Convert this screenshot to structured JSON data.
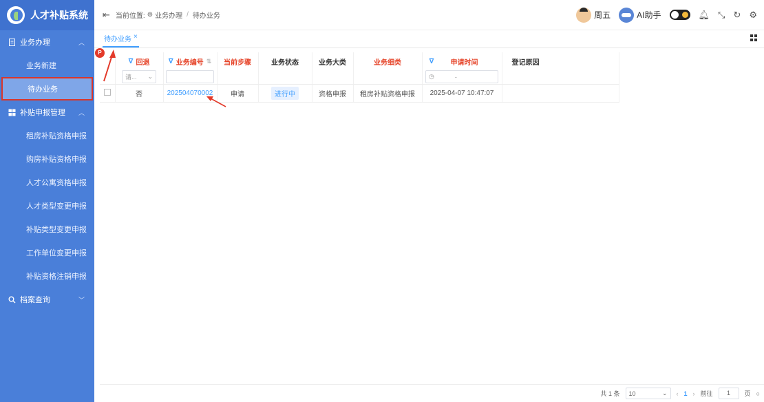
{
  "app": {
    "title": "人才补贴系统"
  },
  "sidebar": {
    "groups": [
      {
        "label": "业务办理",
        "items": [
          {
            "label": "业务新建"
          },
          {
            "label": "待办业务"
          }
        ]
      },
      {
        "label": "补贴申报管理",
        "items": [
          {
            "label": "租房补贴资格申报"
          },
          {
            "label": "购房补贴资格申报"
          },
          {
            "label": "人才公寓资格申报"
          },
          {
            "label": "人才类型变更申报"
          },
          {
            "label": "补贴类型变更申报"
          },
          {
            "label": "工作单位变更申报"
          },
          {
            "label": "补贴资格注销申报"
          }
        ]
      },
      {
        "label": "档案查询",
        "items": []
      }
    ]
  },
  "header": {
    "breadcrumb_prefix": "当前位置:",
    "breadcrumb": [
      "业务办理",
      "待办业务"
    ],
    "user": "周五",
    "assistant": "AI助手"
  },
  "tabs": [
    {
      "label": "待办业务",
      "close": "×"
    }
  ],
  "badge": "P",
  "table": {
    "columns": [
      {
        "label": "回退",
        "filter": true,
        "filter_placeholder": "请...",
        "red": true
      },
      {
        "label": "业务编号",
        "filter": true,
        "sortable": true,
        "red": true
      },
      {
        "label": "当前步骤",
        "red": true
      },
      {
        "label": "业务状态",
        "red": false
      },
      {
        "label": "业务大类",
        "red": false
      },
      {
        "label": "业务细类",
        "red": true
      },
      {
        "label": "申请时间",
        "filter": true,
        "red": true,
        "range_sep": "-"
      },
      {
        "label": "登记原因",
        "red": false
      }
    ],
    "rows": [
      {
        "rollback": "否",
        "number": "202504070002",
        "step": "申请",
        "status": "进行中",
        "category": "资格申报",
        "subcategory": "租房补贴资格申报",
        "time": "2025-04-07 10:47:07",
        "reason": ""
      }
    ]
  },
  "pagination": {
    "total": "共 1 条",
    "page_size": "10",
    "current_page": "1",
    "goto_label": "前往",
    "goto_value": "1",
    "page_suffix": "页"
  },
  "colors": {
    "sidebar": "#4a7fd9",
    "accent": "#409eff",
    "highlight_red": "#e6462b"
  }
}
